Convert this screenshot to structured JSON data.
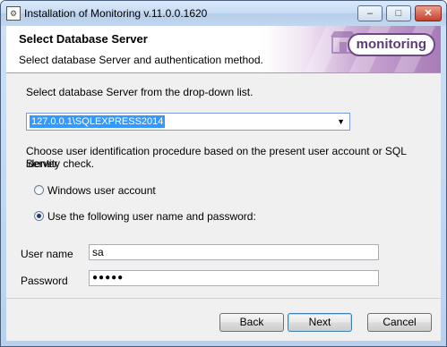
{
  "window": {
    "title": "Installation of Monitoring v.11.0.0.1620",
    "icon": "installer-icon",
    "caption_buttons": {
      "minimize": "–",
      "maximize": "□",
      "close": "✕"
    }
  },
  "banner": {
    "title": "Select Database Server",
    "subtitle": "Select database Server and authentication method.",
    "logo_text": "monitoring"
  },
  "content": {
    "server_instruction": "Select database Server from the drop-down list.",
    "server_select": {
      "value": "127.0.0.1\\SQLEXPRESS2014"
    },
    "auth_instruction_line1": "Choose user identification procedure based on the present user account or SQL Server",
    "auth_instruction_line2": "identity check.",
    "auth_options": [
      {
        "label": "Windows user account",
        "selected": false
      },
      {
        "label": "Use the following user name and password:",
        "selected": true
      }
    ],
    "username": {
      "label": "User name",
      "value": "sa"
    },
    "password": {
      "label": "Password",
      "value": "●●●●●"
    }
  },
  "buttons": {
    "back": "Back",
    "next": "Next",
    "cancel": "Cancel"
  }
}
